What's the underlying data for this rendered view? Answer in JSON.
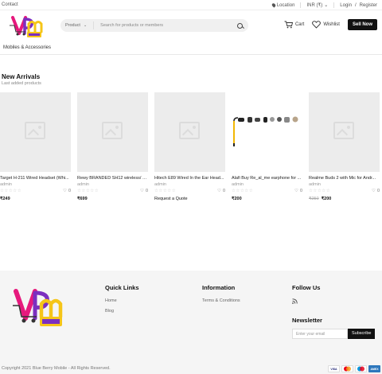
{
  "topbar": {
    "contact": "Contact",
    "location": "Location",
    "currency": "INR (₹)",
    "login": "Login",
    "slash": "/",
    "register": "Register"
  },
  "header": {
    "search_category": "Product",
    "search_placeholder": "Search for products or members",
    "cart": "Cart",
    "wishlist": "Wishlist",
    "sell_now": "Sell Now"
  },
  "nav": {
    "items": [
      "Mobiles & Accessories"
    ]
  },
  "section": {
    "title": "New Arrivals",
    "subtitle": "Last added products"
  },
  "products": [
    {
      "name": "Target H-211 Wired Headset (Whi...",
      "seller": "admin",
      "likes": "0",
      "price": "₹249",
      "old_price": "",
      "image": "placeholder"
    },
    {
      "name": "Rewy BRANDED SH12 wireless/ Bl...",
      "seller": "admin",
      "likes": "0",
      "price": "₹699",
      "old_price": "",
      "image": "placeholder"
    },
    {
      "name": "Hitech E89 Wired In the Ear Head...",
      "seller": "admin",
      "likes": "0",
      "price": "Request a Quote",
      "old_price": "",
      "image": "placeholder"
    },
    {
      "name": "Alafi Buy Re_al_me earphone for ...",
      "seller": "admin",
      "likes": "0",
      "price": "₹200",
      "old_price": "",
      "image": "earphones"
    },
    {
      "name": "Realme Buds 2 with Mic for Andr...",
      "seller": "admin",
      "likes": "0",
      "price": "₹200",
      "old_price": "₹250",
      "image": "placeholder"
    }
  ],
  "footer": {
    "quick_links_title": "Quick Links",
    "quick_links": [
      "Home",
      "Blog"
    ],
    "information_title": "Information",
    "information_links": [
      "Terms & Conditions"
    ],
    "follow_title": "Follow Us",
    "newsletter_title": "Newsletter",
    "newsletter_placeholder": "Enter your email",
    "subscribe": "Subscribe",
    "copyright": "Copyright 2021 Blue Berry Mobile - All Rights Reserved.",
    "payment_cards": [
      "VISA",
      "MC",
      "MAESTRO",
      "AMEX"
    ]
  },
  "colors": {
    "accent": "#111111",
    "logo_pink": "#e6197d",
    "logo_yellow": "#f5c518",
    "logo_purple": "#7b2fbf"
  }
}
